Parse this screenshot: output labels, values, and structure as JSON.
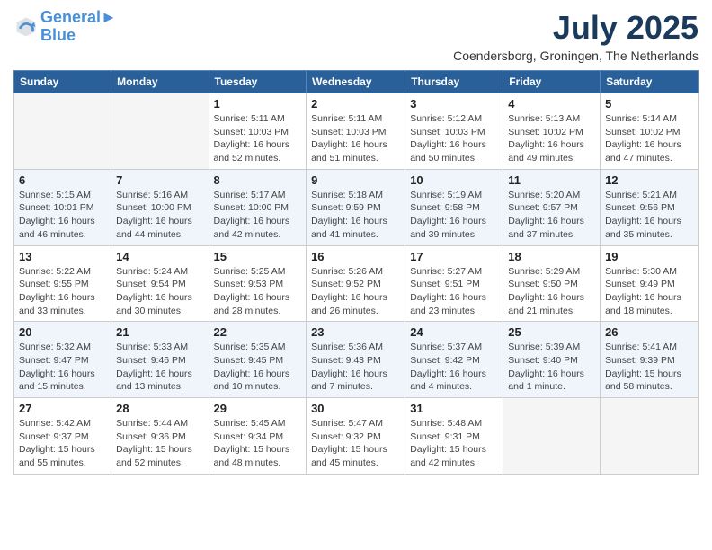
{
  "header": {
    "logo_line1": "General",
    "logo_line2": "Blue",
    "month_title": "July 2025",
    "subtitle": "Coendersborg, Groningen, The Netherlands"
  },
  "weekdays": [
    "Sunday",
    "Monday",
    "Tuesday",
    "Wednesday",
    "Thursday",
    "Friday",
    "Saturday"
  ],
  "weeks": [
    [
      {
        "num": "",
        "sunrise": "",
        "sunset": "",
        "daylight": ""
      },
      {
        "num": "",
        "sunrise": "",
        "sunset": "",
        "daylight": ""
      },
      {
        "num": "1",
        "sunrise": "Sunrise: 5:11 AM",
        "sunset": "Sunset: 10:03 PM",
        "daylight": "Daylight: 16 hours and 52 minutes."
      },
      {
        "num": "2",
        "sunrise": "Sunrise: 5:11 AM",
        "sunset": "Sunset: 10:03 PM",
        "daylight": "Daylight: 16 hours and 51 minutes."
      },
      {
        "num": "3",
        "sunrise": "Sunrise: 5:12 AM",
        "sunset": "Sunset: 10:03 PM",
        "daylight": "Daylight: 16 hours and 50 minutes."
      },
      {
        "num": "4",
        "sunrise": "Sunrise: 5:13 AM",
        "sunset": "Sunset: 10:02 PM",
        "daylight": "Daylight: 16 hours and 49 minutes."
      },
      {
        "num": "5",
        "sunrise": "Sunrise: 5:14 AM",
        "sunset": "Sunset: 10:02 PM",
        "daylight": "Daylight: 16 hours and 47 minutes."
      }
    ],
    [
      {
        "num": "6",
        "sunrise": "Sunrise: 5:15 AM",
        "sunset": "Sunset: 10:01 PM",
        "daylight": "Daylight: 16 hours and 46 minutes."
      },
      {
        "num": "7",
        "sunrise": "Sunrise: 5:16 AM",
        "sunset": "Sunset: 10:00 PM",
        "daylight": "Daylight: 16 hours and 44 minutes."
      },
      {
        "num": "8",
        "sunrise": "Sunrise: 5:17 AM",
        "sunset": "Sunset: 10:00 PM",
        "daylight": "Daylight: 16 hours and 42 minutes."
      },
      {
        "num": "9",
        "sunrise": "Sunrise: 5:18 AM",
        "sunset": "Sunset: 9:59 PM",
        "daylight": "Daylight: 16 hours and 41 minutes."
      },
      {
        "num": "10",
        "sunrise": "Sunrise: 5:19 AM",
        "sunset": "Sunset: 9:58 PM",
        "daylight": "Daylight: 16 hours and 39 minutes."
      },
      {
        "num": "11",
        "sunrise": "Sunrise: 5:20 AM",
        "sunset": "Sunset: 9:57 PM",
        "daylight": "Daylight: 16 hours and 37 minutes."
      },
      {
        "num": "12",
        "sunrise": "Sunrise: 5:21 AM",
        "sunset": "Sunset: 9:56 PM",
        "daylight": "Daylight: 16 hours and 35 minutes."
      }
    ],
    [
      {
        "num": "13",
        "sunrise": "Sunrise: 5:22 AM",
        "sunset": "Sunset: 9:55 PM",
        "daylight": "Daylight: 16 hours and 33 minutes."
      },
      {
        "num": "14",
        "sunrise": "Sunrise: 5:24 AM",
        "sunset": "Sunset: 9:54 PM",
        "daylight": "Daylight: 16 hours and 30 minutes."
      },
      {
        "num": "15",
        "sunrise": "Sunrise: 5:25 AM",
        "sunset": "Sunset: 9:53 PM",
        "daylight": "Daylight: 16 hours and 28 minutes."
      },
      {
        "num": "16",
        "sunrise": "Sunrise: 5:26 AM",
        "sunset": "Sunset: 9:52 PM",
        "daylight": "Daylight: 16 hours and 26 minutes."
      },
      {
        "num": "17",
        "sunrise": "Sunrise: 5:27 AM",
        "sunset": "Sunset: 9:51 PM",
        "daylight": "Daylight: 16 hours and 23 minutes."
      },
      {
        "num": "18",
        "sunrise": "Sunrise: 5:29 AM",
        "sunset": "Sunset: 9:50 PM",
        "daylight": "Daylight: 16 hours and 21 minutes."
      },
      {
        "num": "19",
        "sunrise": "Sunrise: 5:30 AM",
        "sunset": "Sunset: 9:49 PM",
        "daylight": "Daylight: 16 hours and 18 minutes."
      }
    ],
    [
      {
        "num": "20",
        "sunrise": "Sunrise: 5:32 AM",
        "sunset": "Sunset: 9:47 PM",
        "daylight": "Daylight: 16 hours and 15 minutes."
      },
      {
        "num": "21",
        "sunrise": "Sunrise: 5:33 AM",
        "sunset": "Sunset: 9:46 PM",
        "daylight": "Daylight: 16 hours and 13 minutes."
      },
      {
        "num": "22",
        "sunrise": "Sunrise: 5:35 AM",
        "sunset": "Sunset: 9:45 PM",
        "daylight": "Daylight: 16 hours and 10 minutes."
      },
      {
        "num": "23",
        "sunrise": "Sunrise: 5:36 AM",
        "sunset": "Sunset: 9:43 PM",
        "daylight": "Daylight: 16 hours and 7 minutes."
      },
      {
        "num": "24",
        "sunrise": "Sunrise: 5:37 AM",
        "sunset": "Sunset: 9:42 PM",
        "daylight": "Daylight: 16 hours and 4 minutes."
      },
      {
        "num": "25",
        "sunrise": "Sunrise: 5:39 AM",
        "sunset": "Sunset: 9:40 PM",
        "daylight": "Daylight: 16 hours and 1 minute."
      },
      {
        "num": "26",
        "sunrise": "Sunrise: 5:41 AM",
        "sunset": "Sunset: 9:39 PM",
        "daylight": "Daylight: 15 hours and 58 minutes."
      }
    ],
    [
      {
        "num": "27",
        "sunrise": "Sunrise: 5:42 AM",
        "sunset": "Sunset: 9:37 PM",
        "daylight": "Daylight: 15 hours and 55 minutes."
      },
      {
        "num": "28",
        "sunrise": "Sunrise: 5:44 AM",
        "sunset": "Sunset: 9:36 PM",
        "daylight": "Daylight: 15 hours and 52 minutes."
      },
      {
        "num": "29",
        "sunrise": "Sunrise: 5:45 AM",
        "sunset": "Sunset: 9:34 PM",
        "daylight": "Daylight: 15 hours and 48 minutes."
      },
      {
        "num": "30",
        "sunrise": "Sunrise: 5:47 AM",
        "sunset": "Sunset: 9:32 PM",
        "daylight": "Daylight: 15 hours and 45 minutes."
      },
      {
        "num": "31",
        "sunrise": "Sunrise: 5:48 AM",
        "sunset": "Sunset: 9:31 PM",
        "daylight": "Daylight: 15 hours and 42 minutes."
      },
      {
        "num": "",
        "sunrise": "",
        "sunset": "",
        "daylight": ""
      },
      {
        "num": "",
        "sunrise": "",
        "sunset": "",
        "daylight": ""
      }
    ]
  ]
}
